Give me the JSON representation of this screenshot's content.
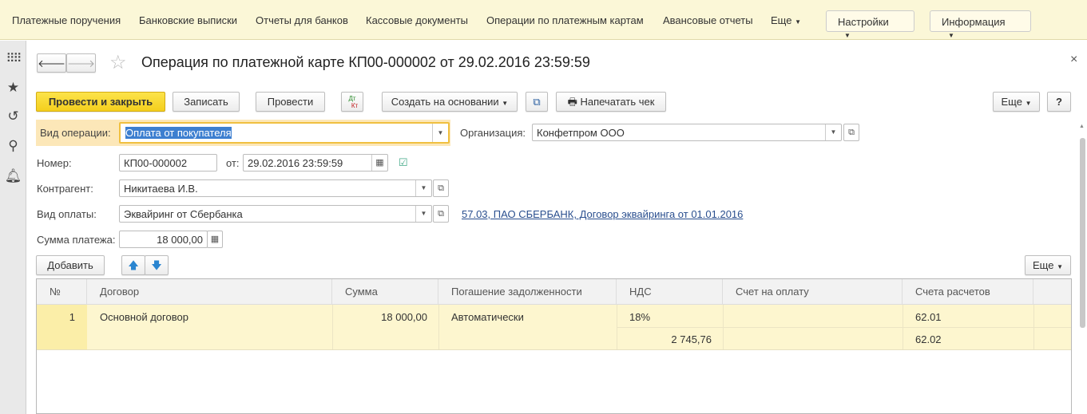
{
  "topnav": {
    "items": [
      "Платежные поручения",
      "Банковские выписки",
      "Отчеты для банков",
      "Кассовые документы",
      "Операции по платежным картам",
      "Авансовые отчеты",
      "Еще"
    ],
    "settings": "Настройки",
    "info": "Информация"
  },
  "sidebar": {
    "icons": [
      "grid-icon",
      "star-icon",
      "history-icon",
      "search-icon",
      "bell-icon"
    ]
  },
  "header": {
    "title": "Операция по платежной карте КП00-000002 от 29.02.2016 23:59:59",
    "close": "×"
  },
  "toolbar": {
    "post_close": "Провести и закрыть",
    "save": "Записать",
    "post": "Провести",
    "dtkt_top": "Дт",
    "dtkt_bottom": "Кт",
    "create_based": "Создать на основании",
    "print_receipt": "Напечатать чек",
    "more": "Еще",
    "help": "?"
  },
  "form": {
    "op_type_label": "Вид операции:",
    "op_type_value": "Оплата от покупателя",
    "org_label": "Организация:",
    "org_value": "Конфетпром ООО",
    "number_label": "Номер:",
    "number_value": "КП00-000002",
    "date_label": "от:",
    "date_value": "29.02.2016 23:59:59",
    "counterparty_label": "Контрагент:",
    "counterparty_value": "Никитаева И.В.",
    "payment_type_label": "Вид оплаты:",
    "payment_type_value": "Эквайринг от Сбербанка",
    "payment_link": "57.03, ПАО СБЕРБАНК, Договор эквайринга от 01.01.2016",
    "amount_label": "Сумма платежа:",
    "amount_value": "18 000,00"
  },
  "table_toolbar": {
    "add": "Добавить",
    "more": "Еще"
  },
  "table": {
    "columns": [
      "№",
      "Договор",
      "Сумма",
      "Погашение задолженности",
      "НДС",
      "Счет на оплату",
      "Счета расчетов"
    ],
    "rows": [
      {
        "n": "1",
        "contract": "Основной договор",
        "sum": "18 000,00",
        "repayment": "Автоматически",
        "vat_rate": "18%",
        "vat_sum": "2 745,76",
        "invoice": "",
        "account1": "62.01",
        "account2": "62.02"
      }
    ]
  },
  "colors": {
    "accent": "#f4cf1d",
    "topbar": "#fbf7d7",
    "row_selected": "#fdf6cf",
    "link": "#2a4f8f"
  }
}
